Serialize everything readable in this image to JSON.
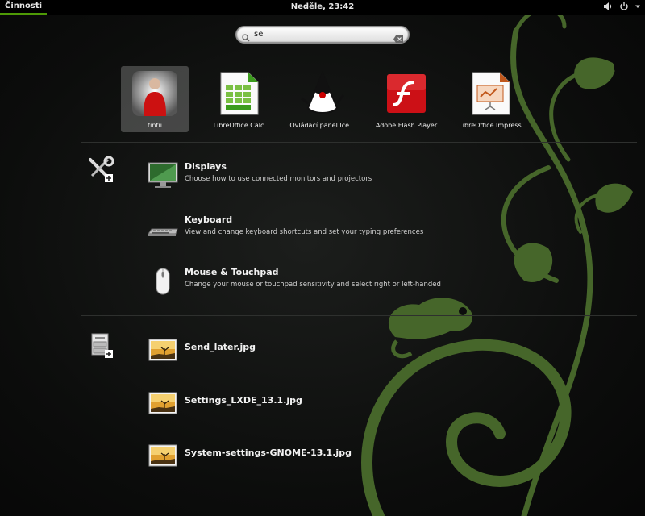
{
  "topbar": {
    "activities_label": "Činnosti",
    "clock": "Neděle, 23:42",
    "icons": [
      "volume-icon",
      "power-icon"
    ]
  },
  "search": {
    "value": "se",
    "icon": "search-icon",
    "clear_icon": "clear-icon"
  },
  "apps": [
    {
      "label": "tintii",
      "icon": "person-photo-icon",
      "selected": true
    },
    {
      "label": "LibreOffice Calc",
      "icon": "spreadsheet-icon"
    },
    {
      "label": "Ovládací panel Ice...",
      "icon": "java-duke-icon"
    },
    {
      "label": "Adobe Flash Player",
      "icon": "flash-icon"
    },
    {
      "label": "LibreOffice Impress",
      "icon": "presentation-icon"
    }
  ],
  "settings_provider": {
    "icon": "tools-icon",
    "items": [
      {
        "title": "Displays",
        "description": "Choose how to use connected monitors and projectors",
        "icon": "monitor-icon"
      },
      {
        "title": "Keyboard",
        "description": "View and change keyboard shortcuts and set your typing preferences",
        "icon": "keyboard-icon"
      },
      {
        "title": "Mouse & Touchpad",
        "description": "Change your mouse or touchpad sensitivity and select right or left-handed",
        "icon": "mouse-icon"
      }
    ]
  },
  "files_provider": {
    "icon": "file-manager-icon",
    "items": [
      {
        "title": "Send_later.jpg",
        "icon": "image-file-icon"
      },
      {
        "title": "Settings_LXDE_13.1.jpg",
        "icon": "image-file-icon"
      },
      {
        "title": "System-settings-GNOME-13.1.jpg",
        "icon": "image-file-icon"
      }
    ]
  },
  "colors": {
    "accent": "#4e9a06",
    "swirl": "#3d5a1e",
    "background": "#0c0d0c"
  }
}
